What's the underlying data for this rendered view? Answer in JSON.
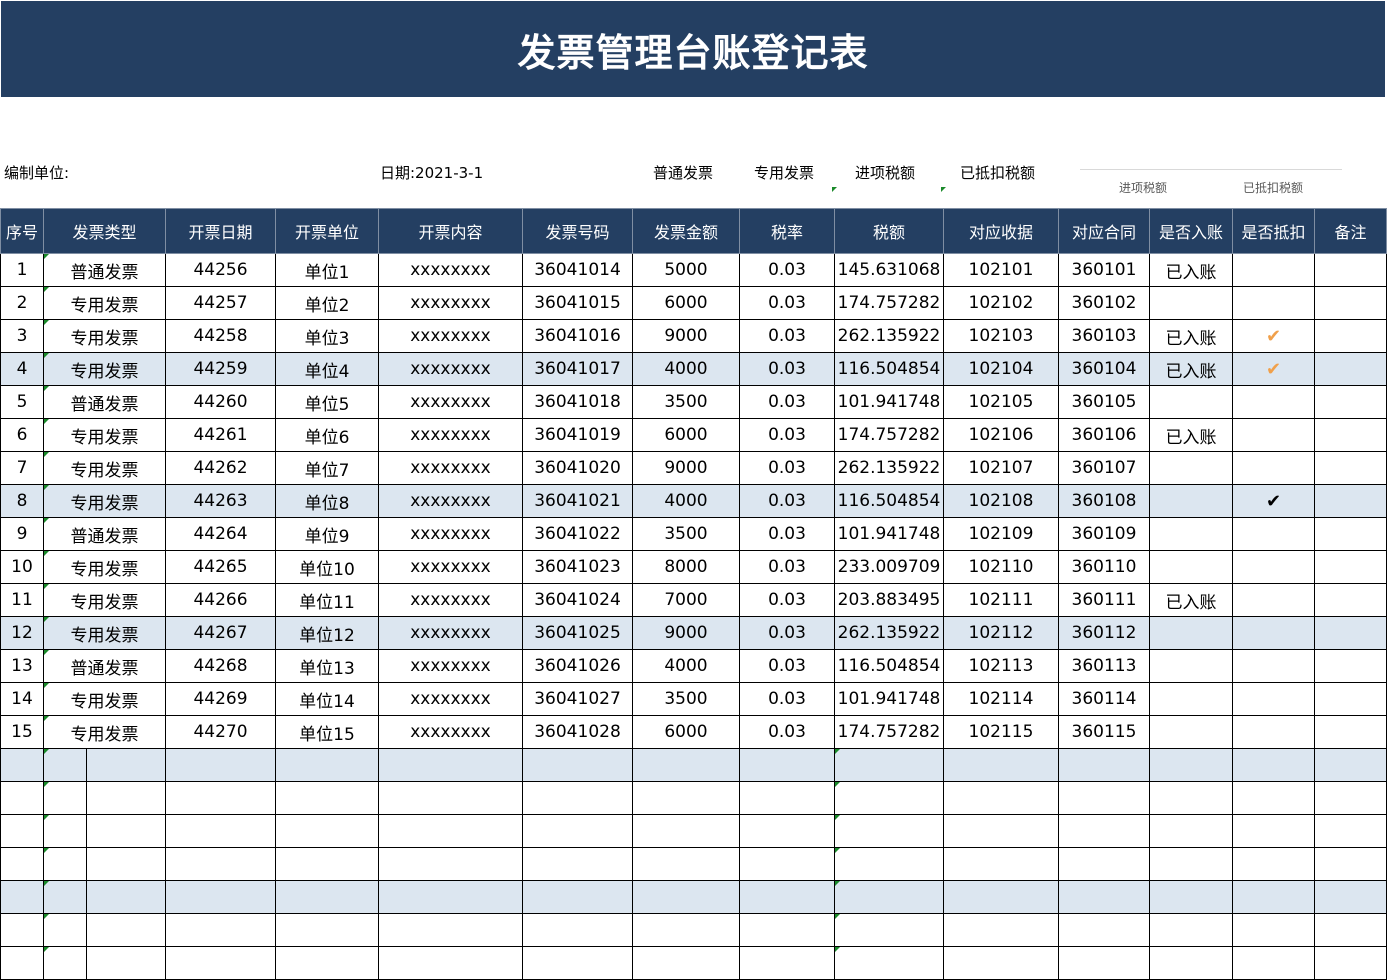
{
  "title": "发票管理台账登记表",
  "info": {
    "unit_label": "编制单位:",
    "date_label": "日期:2021-3-1",
    "legend": [
      "普通发票",
      "专用发票",
      "进项税额",
      "已抵扣税额"
    ],
    "legend_small": [
      "进项税额",
      "已抵扣税额"
    ]
  },
  "table": {
    "headers": [
      "序号",
      "发票类型",
      "开票日期",
      "开票单位",
      "开票内容",
      "发票号码",
      "发票金额",
      "税率",
      "税额",
      "对应收据",
      "对应合同",
      "是否入账",
      "是否抵扣",
      "备注"
    ],
    "rows": [
      {
        "no": "1",
        "type": "普通发票",
        "date": "44256",
        "unit": "单位1",
        "content": "xxxxxxxx",
        "number": "36041014",
        "amount": "5000",
        "rate": "0.03",
        "tax": "145.631068",
        "receipt": "102101",
        "contract": "360101",
        "booked": "已入账",
        "deducted": "",
        "remark": ""
      },
      {
        "no": "2",
        "type": "专用发票",
        "date": "44257",
        "unit": "单位2",
        "content": "xxxxxxxx",
        "number": "36041015",
        "amount": "6000",
        "rate": "0.03",
        "tax": "174.757282",
        "receipt": "102102",
        "contract": "360102",
        "booked": "",
        "deducted": "",
        "remark": ""
      },
      {
        "no": "3",
        "type": "专用发票",
        "date": "44258",
        "unit": "单位3",
        "content": "xxxxxxxx",
        "number": "36041016",
        "amount": "9000",
        "rate": "0.03",
        "tax": "262.135922",
        "receipt": "102103",
        "contract": "360103",
        "booked": "已入账",
        "deducted": "✔",
        "remark": ""
      },
      {
        "no": "4",
        "type": "专用发票",
        "date": "44259",
        "unit": "单位4",
        "content": "xxxxxxxx",
        "number": "36041017",
        "amount": "4000",
        "rate": "0.03",
        "tax": "116.504854",
        "receipt": "102104",
        "contract": "360104",
        "booked": "已入账",
        "deducted": "✔",
        "remark": ""
      },
      {
        "no": "5",
        "type": "普通发票",
        "date": "44260",
        "unit": "单位5",
        "content": "xxxxxxxx",
        "number": "36041018",
        "amount": "3500",
        "rate": "0.03",
        "tax": "101.941748",
        "receipt": "102105",
        "contract": "360105",
        "booked": "",
        "deducted": "",
        "remark": ""
      },
      {
        "no": "6",
        "type": "专用发票",
        "date": "44261",
        "unit": "单位6",
        "content": "xxxxxxxx",
        "number": "36041019",
        "amount": "6000",
        "rate": "0.03",
        "tax": "174.757282",
        "receipt": "102106",
        "contract": "360106",
        "booked": "已入账",
        "deducted": "",
        "remark": ""
      },
      {
        "no": "7",
        "type": "专用发票",
        "date": "44262",
        "unit": "单位7",
        "content": "xxxxxxxx",
        "number": "36041020",
        "amount": "9000",
        "rate": "0.03",
        "tax": "262.135922",
        "receipt": "102107",
        "contract": "360107",
        "booked": "",
        "deducted": "",
        "remark": ""
      },
      {
        "no": "8",
        "type": "专用发票",
        "date": "44263",
        "unit": "单位8",
        "content": "xxxxxxxx",
        "number": "36041021",
        "amount": "4000",
        "rate": "0.03",
        "tax": "116.504854",
        "receipt": "102108",
        "contract": "360108",
        "booked": "",
        "deducted": "✔",
        "remark": ""
      },
      {
        "no": "9",
        "type": "普通发票",
        "date": "44264",
        "unit": "单位9",
        "content": "xxxxxxxx",
        "number": "36041022",
        "amount": "3500",
        "rate": "0.03",
        "tax": "101.941748",
        "receipt": "102109",
        "contract": "360109",
        "booked": "",
        "deducted": "",
        "remark": ""
      },
      {
        "no": "10",
        "type": "专用发票",
        "date": "44265",
        "unit": "单位10",
        "content": "xxxxxxxx",
        "number": "36041023",
        "amount": "8000",
        "rate": "0.03",
        "tax": "233.009709",
        "receipt": "102110",
        "contract": "360110",
        "booked": "",
        "deducted": "",
        "remark": ""
      },
      {
        "no": "11",
        "type": "专用发票",
        "date": "44266",
        "unit": "单位11",
        "content": "xxxxxxxx",
        "number": "36041024",
        "amount": "7000",
        "rate": "0.03",
        "tax": "203.883495",
        "receipt": "102111",
        "contract": "360111",
        "booked": "已入账",
        "deducted": "",
        "remark": ""
      },
      {
        "no": "12",
        "type": "专用发票",
        "date": "44267",
        "unit": "单位12",
        "content": "xxxxxxxx",
        "number": "36041025",
        "amount": "9000",
        "rate": "0.03",
        "tax": "262.135922",
        "receipt": "102112",
        "contract": "360112",
        "booked": "",
        "deducted": "",
        "remark": ""
      },
      {
        "no": "13",
        "type": "普通发票",
        "date": "44268",
        "unit": "单位13",
        "content": "xxxxxxxx",
        "number": "36041026",
        "amount": "4000",
        "rate": "0.03",
        "tax": "116.504854",
        "receipt": "102113",
        "contract": "360113",
        "booked": "",
        "deducted": "",
        "remark": ""
      },
      {
        "no": "14",
        "type": "专用发票",
        "date": "44269",
        "unit": "单位14",
        "content": "xxxxxxxx",
        "number": "36041027",
        "amount": "3500",
        "rate": "0.03",
        "tax": "101.941748",
        "receipt": "102114",
        "contract": "360114",
        "booked": "",
        "deducted": "",
        "remark": ""
      },
      {
        "no": "15",
        "type": "专用发票",
        "date": "44270",
        "unit": "单位15",
        "content": "xxxxxxxx",
        "number": "36041028",
        "amount": "6000",
        "rate": "0.03",
        "tax": "174.757282",
        "receipt": "102115",
        "contract": "360115",
        "booked": "",
        "deducted": "",
        "remark": ""
      }
    ],
    "shaded_rows": [
      4,
      8,
      12,
      16,
      20
    ],
    "orange_check_rows": [
      3,
      4
    ],
    "empty_rows": 7
  },
  "colors": {
    "header_bg": "#243f62",
    "shade_bg": "#dce6f0",
    "check_orange": "#f0a04b",
    "comment_marker": "#1a8a2a"
  }
}
